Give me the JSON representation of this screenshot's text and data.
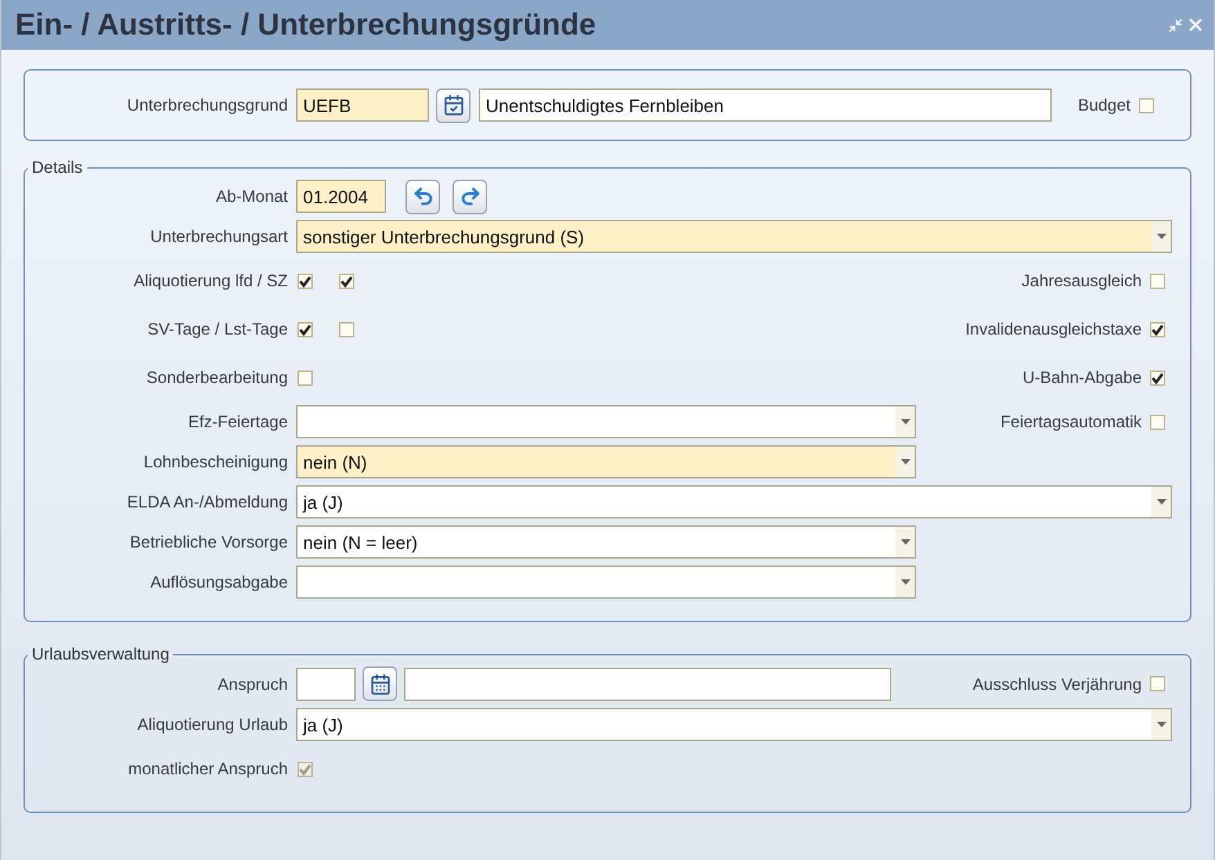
{
  "window": {
    "title": "Ein- / Austritts- / Unterbrechungsgründe"
  },
  "header": {
    "label": "Unterbrechungsgrund",
    "code": "UEFB",
    "description": "Unentschuldigtes Fernbleiben",
    "budget": {
      "label": "Budget",
      "checked": false
    }
  },
  "details": {
    "legend": "Details",
    "rows": [
      {
        "kind": "date",
        "label": "Ab-Monat",
        "value": "01.2004",
        "highlighted": true
      },
      {
        "kind": "select",
        "label": "Unterbrechungsart",
        "value": "sonstiger Unterbrechungsgrund (S)",
        "highlighted": true,
        "wide": true
      },
      {
        "kind": "checks",
        "label": "Aliquotierung lfd / SZ",
        "checks": [
          {
            "checked": true,
            "disabled": false
          },
          {
            "checked": true,
            "disabled": false
          }
        ],
        "right": {
          "label": "Jahresausgleich",
          "checked": false
        }
      },
      {
        "kind": "checks",
        "label": "SV-Tage / Lst-Tage",
        "checks": [
          {
            "checked": true,
            "disabled": false
          },
          {
            "checked": false,
            "disabled": false
          }
        ],
        "right": {
          "label": "Invalidenausgleichstaxe",
          "checked": true
        }
      },
      {
        "kind": "checks",
        "label": "Sonderbearbeitung",
        "checks": [
          {
            "checked": false,
            "disabled": false
          }
        ],
        "right": {
          "label": "U-Bahn-Abgabe",
          "checked": true
        }
      },
      {
        "kind": "select",
        "label": "Efz-Feiertage",
        "highlighted": false,
        "wide": false,
        "right": {
          "label": "Feiertagsautomatik",
          "checked": false
        }
      },
      {
        "kind": "select",
        "label": "Lohnbescheinigung",
        "value": "nein (N)",
        "highlighted": true,
        "wide": false
      },
      {
        "kind": "select",
        "label": "ELDA An-/Abmeldung",
        "value": "ja (J)",
        "highlighted": false,
        "wide": true
      },
      {
        "kind": "select",
        "label": "Betriebliche Vorsorge",
        "value": "nein (N = leer)",
        "highlighted": false,
        "wide": false
      },
      {
        "kind": "select",
        "label": "Auflösungsabgabe",
        "highlighted": false,
        "wide": false
      }
    ]
  },
  "vacation": {
    "legend": "Urlaubsverwaltung",
    "rows": [
      {
        "kind": "entitlement",
        "label": "Anspruch",
        "right": {
          "label": "Ausschluss Verjährung",
          "checked": false
        }
      },
      {
        "kind": "select",
        "label": "Aliquotierung Urlaub",
        "value": "ja (J)",
        "highlighted": false,
        "wide": true
      },
      {
        "kind": "checks",
        "label": "monatlicher Anspruch",
        "checks": [
          {
            "checked": true,
            "disabled": true
          }
        ]
      }
    ]
  }
}
